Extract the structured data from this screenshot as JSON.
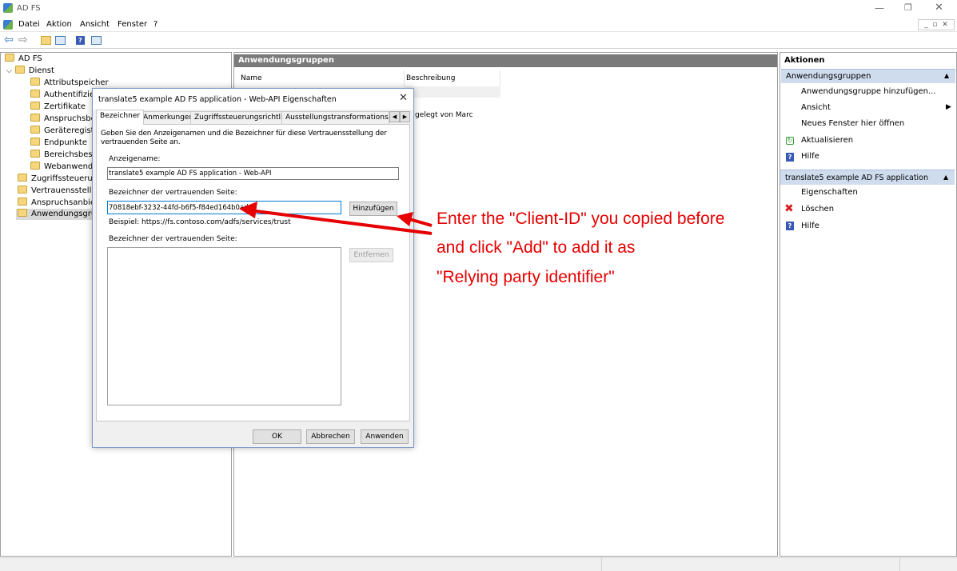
{
  "window": {
    "title": "AD FS"
  },
  "menu": [
    "Datei",
    "Aktion",
    "Ansicht",
    "Fenster",
    "?"
  ],
  "tree": {
    "root": "AD FS",
    "service": "Dienst",
    "service_children": [
      "Attributspeicher",
      "Authentifizier",
      "Zertifikate",
      "Anspruchsbesc",
      "Geräteregistrie",
      "Endpunkte",
      "Bereichsbesch",
      "Webanwendu"
    ],
    "top_items": [
      "Zugriffssteuerung",
      "Vertrauensstellung",
      "Anspruchsanbiete",
      "Anwendungsgrup"
    ]
  },
  "middle": {
    "header": "Anwendungsgruppen",
    "columns": [
      "Name",
      "Beschreibung"
    ],
    "row_desc_partial": "gelegt von Marc"
  },
  "actions": {
    "title": "Aktionen",
    "section1": "Anwendungsgruppen",
    "items1": [
      "Anwendungsgruppe hinzufügen...",
      "Ansicht",
      "Neues Fenster hier öffnen",
      "Aktualisieren",
      "Hilfe"
    ],
    "section2": "translate5 example AD FS application",
    "items2": [
      "Eigenschaften",
      "Löschen",
      "Hilfe"
    ]
  },
  "dialog": {
    "title": "translate5 example AD FS application - Web-API Eigenschaften",
    "tabs": [
      "Bezeichner",
      "Anmerkungen",
      "Zugriffssteuerungsrichtlinie",
      "Ausstellungstransformationsregeln"
    ],
    "description": "Geben Sie den Anzeigenamen und die Bezeichner für diese Vertrauensstellung der vertrauenden Seite an.",
    "display_name_label": "Anzeigename:",
    "display_name_value": "translate5 example AD FS application - Web-API",
    "rp_id_label": "Bezeichner der vertrauenden Seite:",
    "rp_id_value": "70818ebf-3232-44fd-b6f5-f84ed164b0ad",
    "add_button": "Hinzufügen",
    "example": "Beispiel: https://fs.contoso.com/adfs/services/trust",
    "rp_list_label": "Bezeichner der vertrauenden Seite:",
    "remove_button": "Entfernen",
    "ok": "OK",
    "cancel": "Abbrechen",
    "apply": "Anwenden"
  },
  "annotation": {
    "line1": "Enter the \"Client-ID\" you copied before",
    "line2": "and click \"Add\" to add it as",
    "line3": "\"Relying party identifier\""
  }
}
